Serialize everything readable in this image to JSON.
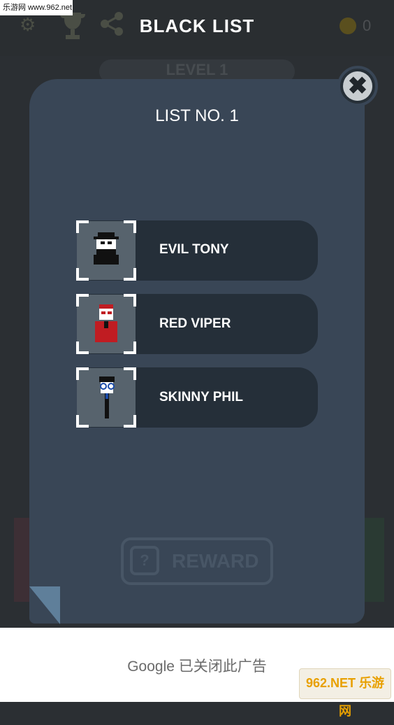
{
  "watermark": "乐游网 www.962.net",
  "header": {
    "title": "BLACK LIST",
    "coins": "0",
    "settings_icon": "gear-icon",
    "trophy_icon": "trophy-icon",
    "share_icon": "share-icon",
    "coin_icon": "coin-icon"
  },
  "level_label": "LEVEL 1",
  "modal": {
    "title": "LIST NO. 1",
    "close_symbol": "✖",
    "entries": [
      {
        "name": "EVIL TONY"
      },
      {
        "name": "RED VIPER"
      },
      {
        "name": "SKINNY PHIL"
      }
    ],
    "reward_icon_symbol": "?",
    "reward_label": "REWARD"
  },
  "ad": {
    "text": "Google 已关闭此广告"
  },
  "corner_logo": "962.NET 乐游网",
  "colors": {
    "modal_bg": "#394656",
    "card_bg": "#252f39",
    "portrait_bg": "#57636d",
    "accent_red": "#c01c22"
  }
}
